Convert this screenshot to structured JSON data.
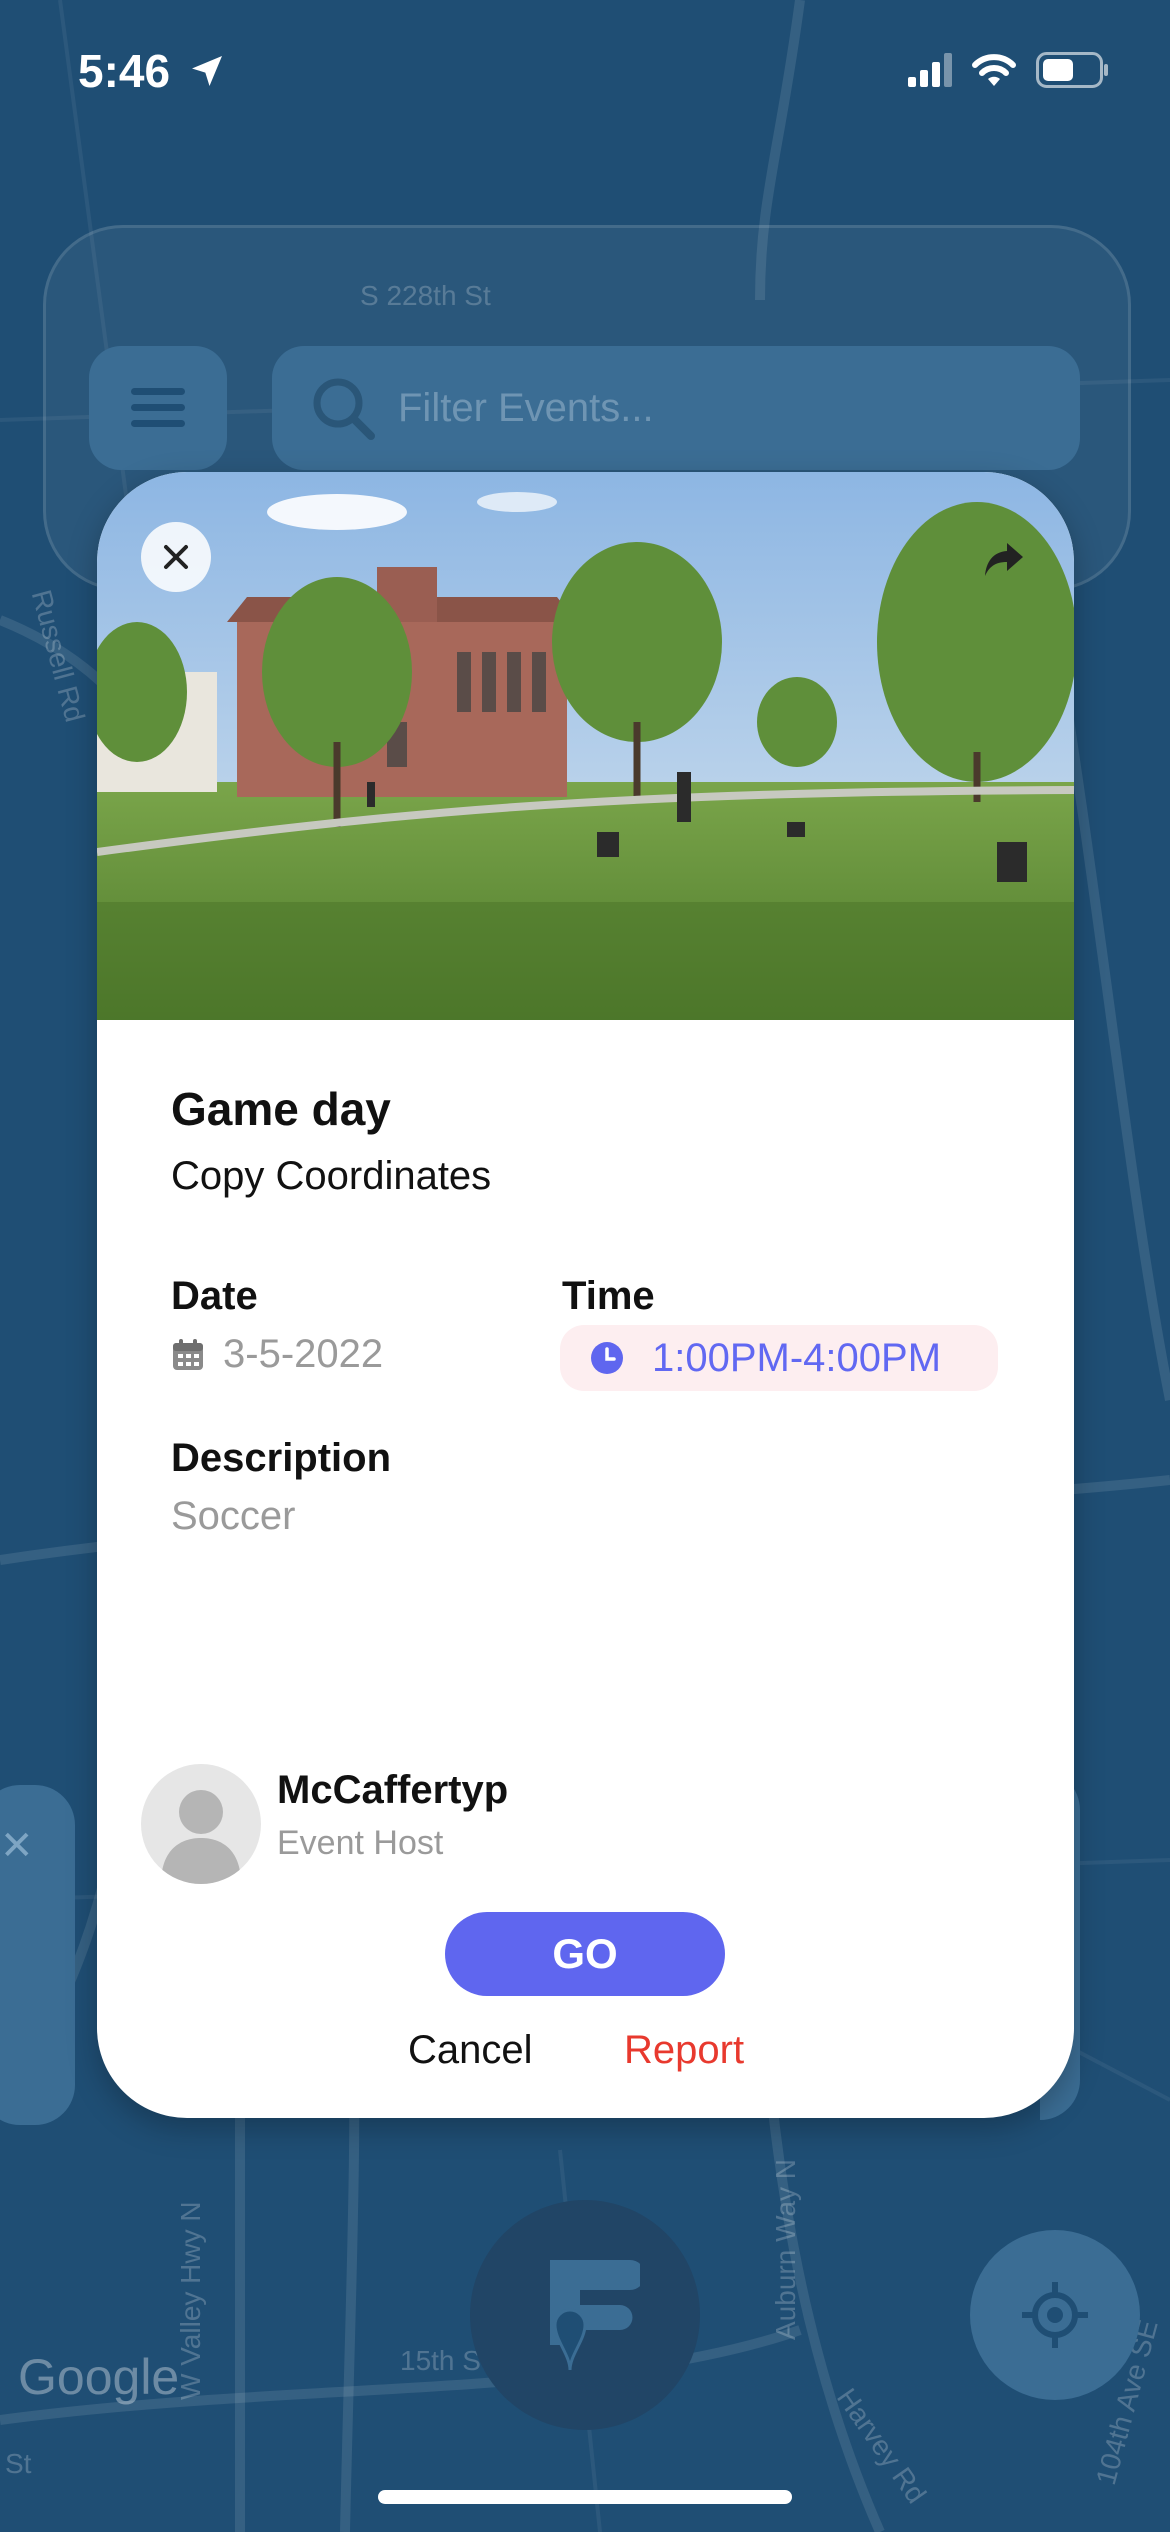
{
  "status_bar": {
    "time": "5:46"
  },
  "search": {
    "placeholder": "Filter Events..."
  },
  "map": {
    "streets": [
      "Russell Rd",
      "S 228th St",
      "15th St",
      "W Valley Hwy N",
      "Auburn Way N",
      "Harvey Rd",
      "104th Ave SE",
      "St"
    ],
    "attribution": "Google"
  },
  "event": {
    "title": "Game day",
    "copy_link": "Copy Coordinates",
    "date_label": "Date",
    "date_value": "3-5-2022",
    "time_label": "Time",
    "time_value": "1:00PM-4:00PM",
    "description_label": "Description",
    "description_value": "Soccer",
    "host_name": "McCaffertyp",
    "host_role": "Event Host",
    "go_label": "GO",
    "cancel_label": "Cancel",
    "report_label": "Report"
  },
  "colors": {
    "map_bg": "#1f4e74",
    "panel": "#3b6d94",
    "accent": "#5f66ef",
    "time_pill_bg": "#fdeef0",
    "report": "#e8392e"
  }
}
